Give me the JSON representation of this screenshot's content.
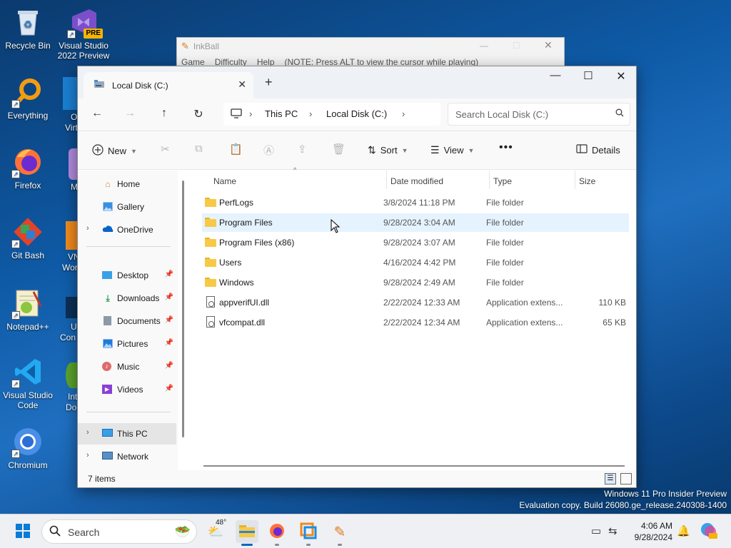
{
  "desktop": {
    "icons": [
      {
        "label": "Recycle Bin",
        "icon": "recycle-bin-icon"
      },
      {
        "label": "Visual Studio 2022 Preview",
        "badge": "PRE",
        "icon": "visual-studio-preview-icon"
      },
      {
        "label": "Everything",
        "icon": "everything-search-icon"
      },
      {
        "label": "Firefox",
        "icon": "firefox-icon"
      },
      {
        "label": "Git Bash",
        "icon": "git-bash-icon"
      },
      {
        "label": "Notepad++",
        "icon": "notepad-plus-plus-icon"
      },
      {
        "label": "Visual Studio Code",
        "icon": "vscode-icon"
      },
      {
        "label": "Chromium",
        "icon": "chromium-icon"
      }
    ],
    "partial_labels": [
      "O",
      "Virt",
      "M",
      "VN",
      "Wor",
      "U",
      "Con",
      "Int",
      "Do"
    ]
  },
  "inkball": {
    "title": "InkBall",
    "menu": [
      "Game",
      "Difficulty",
      "Help",
      "(NOTE: Press ALT to view the cursor while playing)"
    ]
  },
  "explorer": {
    "tab_title": "Local Disk (C:)",
    "breadcrumb": [
      "This PC",
      "Local Disk (C:)"
    ],
    "search_placeholder": "Search Local Disk (C:)",
    "commands": {
      "new": "New",
      "sort": "Sort",
      "view": "View",
      "details": "Details"
    },
    "nav": {
      "home": "Home",
      "gallery": "Gallery",
      "onedrive": "OneDrive",
      "desktop": "Desktop",
      "downloads": "Downloads",
      "documents": "Documents",
      "pictures": "Pictures",
      "music": "Music",
      "videos": "Videos",
      "this_pc": "This PC",
      "network": "Network"
    },
    "columns": {
      "name": "Name",
      "date": "Date modified",
      "type": "Type",
      "size": "Size"
    },
    "files": [
      {
        "name": "PerfLogs",
        "date": "3/8/2024 11:18 PM",
        "type": "File folder",
        "size": "",
        "kind": "folder"
      },
      {
        "name": "Program Files",
        "date": "9/28/2024 3:04 AM",
        "type": "File folder",
        "size": "",
        "kind": "folder"
      },
      {
        "name": "Program Files (x86)",
        "date": "9/28/2024 3:07 AM",
        "type": "File folder",
        "size": "",
        "kind": "folder"
      },
      {
        "name": "Users",
        "date": "4/16/2024 4:42 PM",
        "type": "File folder",
        "size": "",
        "kind": "folder"
      },
      {
        "name": "Windows",
        "date": "9/28/2024 2:49 AM",
        "type": "File folder",
        "size": "",
        "kind": "folder"
      },
      {
        "name": "appverifUI.dll",
        "date": "2/22/2024 12:33 AM",
        "type": "Application extens...",
        "size": "110 KB",
        "kind": "file"
      },
      {
        "name": "vfcompat.dll",
        "date": "2/22/2024 12:34 AM",
        "type": "Application extens...",
        "size": "65 KB",
        "kind": "file"
      }
    ],
    "status": "7 items"
  },
  "watermark": {
    "line1": "Windows 11 Pro Insider Preview",
    "line2": "Evaluation copy. Build 26080.ge_release.240308-1400"
  },
  "taskbar": {
    "search_placeholder": "Search",
    "weather": "48°",
    "time": "4:06 AM",
    "date": "9/28/2024"
  }
}
